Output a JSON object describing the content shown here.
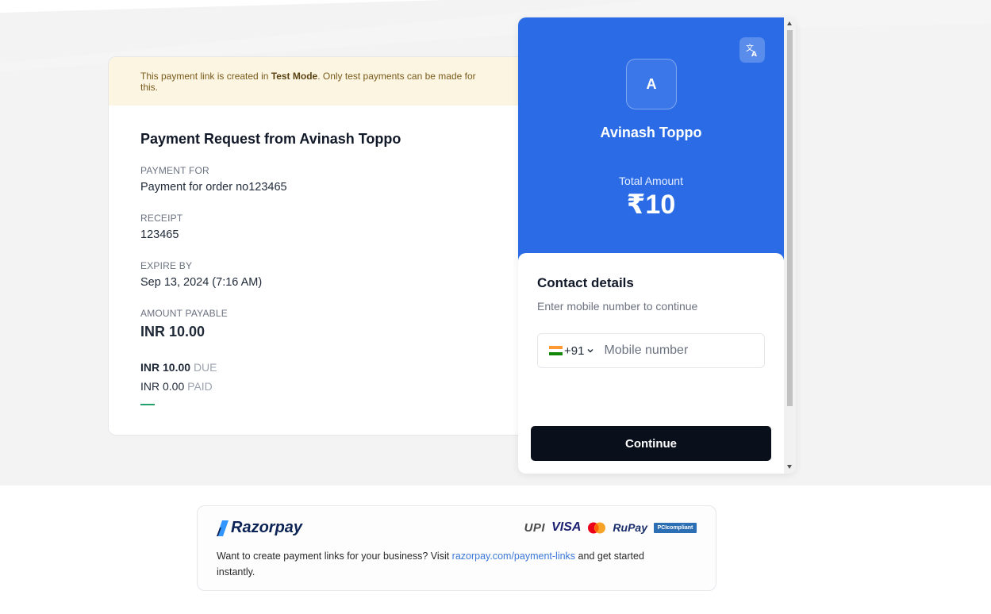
{
  "test_banner": {
    "text_before": "This payment link is created in ",
    "mode": "Test Mode",
    "text_after": ". Only test payments can be made for this."
  },
  "request": {
    "title": "Payment Request from Avinash Toppo",
    "payment_for_label": "PAYMENT FOR",
    "payment_for_value": "Payment for order no123465",
    "receipt_label": "RECEIPT",
    "receipt_value": "123465",
    "expire_label": "EXPIRE BY",
    "expire_value": "Sep 13, 2024 (7:16 AM)",
    "amount_label": "AMOUNT PAYABLE",
    "amount_value": "INR 10.00",
    "due_amount": "INR 10.00",
    "due_tag": "DUE",
    "paid_amount": "INR 0.00",
    "paid_tag": "PAID"
  },
  "checkout": {
    "avatar_initial": "A",
    "merchant_name": "Avinash Toppo",
    "total_label": "Total Amount",
    "total_value": "₹10",
    "contact_title": "Contact details",
    "contact_subtitle": "Enter mobile number to continue",
    "country_code": "+91",
    "phone_placeholder": "Mobile number",
    "continue_label": "Continue",
    "brand_color": "#2b6ce6"
  },
  "footer": {
    "brand": "Razorpay",
    "methods": [
      "UPI",
      "VISA",
      "Mastercard",
      "RuPay",
      "PCI compliant"
    ],
    "upi_label": "UPI",
    "visa_label": "VISA",
    "rupay_label": "RuPay",
    "pci_label": "PCIcompliant",
    "text_before": "Want to create payment links for your business? Visit ",
    "link_text": "razorpay.com/payment-links",
    "text_after": " and get started instantly."
  }
}
